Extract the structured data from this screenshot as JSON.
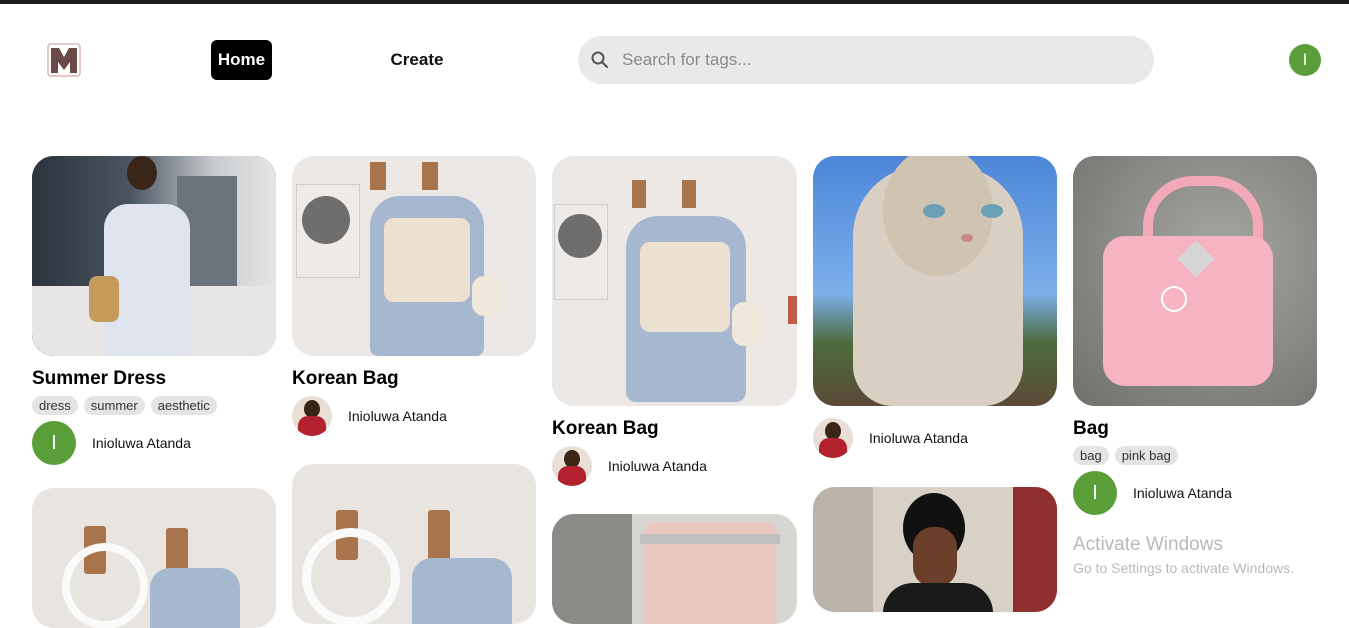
{
  "header": {
    "nav": {
      "home": "Home",
      "create": "Create"
    },
    "search": {
      "placeholder": "Search for tags..."
    },
    "avatar_initial": "I"
  },
  "pins": [
    {
      "title": "Summer Dress",
      "tags": [
        "dress",
        "summer",
        "aesthetic"
      ],
      "author": "Inioluwa Atanda",
      "author_initial": "I"
    },
    {
      "title": "Korean Bag",
      "tags": [],
      "author": "Inioluwa Atanda"
    },
    {
      "title": "Korean Bag",
      "tags": [],
      "author": "Inioluwa Atanda"
    },
    {
      "title": "",
      "tags": [],
      "author": "Inioluwa Atanda"
    },
    {
      "title": "Bag",
      "tags": [
        "bag",
        "pink bag"
      ],
      "author": "Inioluwa Atanda",
      "author_initial": "I"
    }
  ],
  "watermark": {
    "line1": "Activate Windows",
    "line2": "Go to Settings to activate Windows."
  },
  "colors": {
    "accent_black": "#000000",
    "avatar_green": "#5a9e3a",
    "search_bg": "#e9e9e9",
    "tag_bg": "#e4e4e4"
  }
}
